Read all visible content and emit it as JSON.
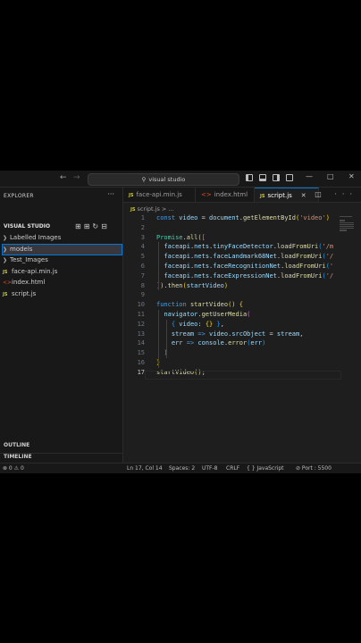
{
  "titlebar": {
    "search_text": "visual studio",
    "back_arrow": "←",
    "forward_arrow": "→",
    "window_controls": [
      "—",
      "□",
      "✕"
    ]
  },
  "sidebar": {
    "header": "EXPLORER",
    "more": "···",
    "section_title": "VISUAL STUDIO",
    "tools": "⊞⊞↻⊟",
    "items": [
      {
        "label": "Labelled Images",
        "kind": "folder",
        "icon": "chevron-right-icon"
      },
      {
        "label": "models",
        "kind": "folder",
        "icon": "chevron-right-icon",
        "selected": true
      },
      {
        "label": "Test_Images",
        "kind": "folder",
        "icon": "chevron-right-icon"
      },
      {
        "label": "face-api.min.js",
        "kind": "js",
        "icon_text": "JS"
      },
      {
        "label": "index.html",
        "kind": "html",
        "icon_text": "<>"
      },
      {
        "label": "script.js",
        "kind": "js",
        "icon_text": "JS"
      }
    ],
    "outline": "OUTLINE",
    "timeline": "TIMELINE"
  },
  "tabs": [
    {
      "label": "face-api.min.js",
      "icon_text": "JS",
      "kind": "js",
      "active": false
    },
    {
      "label": "index.html",
      "icon_text": "<>",
      "kind": "html",
      "active": false
    },
    {
      "label": "script.js",
      "icon_text": "JS",
      "kind": "js",
      "active": true,
      "close": "✕"
    }
  ],
  "tab_actions": "◫ ···",
  "breadcrumb": {
    "icon_text": "JS",
    "text": "script.js > ..."
  },
  "code_lines": [
    {
      "n": "1",
      "html": "<span class=\"kw\">const</span> <span class=\"var\">video</span> <span class=\"pl\">=</span> <span class=\"var\">document</span><span class=\"pl\">.</span><span class=\"fn\">getElementById</span><span class=\"br1\">(</span><span class=\"str\">'video'</span><span class=\"br1\">)</span>"
    },
    {
      "n": "2",
      "html": ""
    },
    {
      "n": "3",
      "html": "<span class=\"obj\">Promise</span><span class=\"pl\">.</span><span class=\"fn\">all</span><span class=\"br1\">(</span><span class=\"br2\">[</span>"
    },
    {
      "n": "4",
      "html": "  <span class=\"var\">faceapi</span><span class=\"pl\">.</span><span class=\"var\">nets</span><span class=\"pl\">.</span><span class=\"var\">tinyFaceDetector</span><span class=\"pl\">.</span><span class=\"fn\">loadFromUri</span><span class=\"br3\">(</span><span class=\"str\">'/m</span>"
    },
    {
      "n": "5",
      "html": "  <span class=\"var\">faceapi</span><span class=\"pl\">.</span><span class=\"var\">nets</span><span class=\"pl\">.</span><span class=\"var\">faceLandmark68Net</span><span class=\"pl\">.</span><span class=\"fn\">loadFromUri</span><span class=\"br3\">(</span><span class=\"str\">'/</span>"
    },
    {
      "n": "6",
      "html": "  <span class=\"var\">faceapi</span><span class=\"pl\">.</span><span class=\"var\">nets</span><span class=\"pl\">.</span><span class=\"var\">faceRecognitionNet</span><span class=\"pl\">.</span><span class=\"fn\">loadFromUri</span><span class=\"br3\">(</span><span class=\"str\">'</span>"
    },
    {
      "n": "7",
      "html": "  <span class=\"var\">faceapi</span><span class=\"pl\">.</span><span class=\"var\">nets</span><span class=\"pl\">.</span><span class=\"var\">faceExpressionNet</span><span class=\"pl\">.</span><span class=\"fn\">loadFromUri</span><span class=\"br3\">(</span><span class=\"str\">'/</span>"
    },
    {
      "n": "8",
      "html": "<span class=\"br2\">]</span><span class=\"br1\">)</span><span class=\"pl\">.</span><span class=\"fn\">then</span><span class=\"br1\">(</span><span class=\"var\">startVideo</span><span class=\"br1\">)</span>"
    },
    {
      "n": "9",
      "html": ""
    },
    {
      "n": "10",
      "html": "<span class=\"kw\">function</span> <span class=\"fn\">startVideo</span><span class=\"br1\">()</span> <span class=\"br1\">{</span>"
    },
    {
      "n": "11",
      "html": "  <span class=\"var\">navigator</span><span class=\"pl\">.</span><span class=\"fn\">getUserMedia</span><span class=\"br2\">(</span>"
    },
    {
      "n": "12",
      "html": "    <span class=\"br3\">{</span> <span class=\"var\">video</span><span class=\"pl\">:</span> <span class=\"br1\">{}</span> <span class=\"br3\">}</span><span class=\"pl\">,</span>"
    },
    {
      "n": "13",
      "html": "    <span class=\"var\">stream</span> <span class=\"kw\">=&gt;</span> <span class=\"var\">video</span><span class=\"pl\">.</span><span class=\"var\">srcObject</span> <span class=\"pl\">=</span> <span class=\"var\">stream</span><span class=\"pl\">,</span>"
    },
    {
      "n": "14",
      "html": "    <span class=\"var\">err</span> <span class=\"kw\">=&gt;</span> <span class=\"var\">console</span><span class=\"pl\">.</span><span class=\"fn\">error</span><span class=\"br3\">(</span><span class=\"var\">err</span><span class=\"br3\">)</span>"
    },
    {
      "n": "15",
      "html": "  <span class=\"br2\">)</span>"
    },
    {
      "n": "16",
      "html": "<span class=\"br1\">}</span>"
    },
    {
      "n": "17",
      "html": "<span class=\"fn\">startVideo</span><span class=\"br1\">()</span><span class=\"pl\">;</span>"
    }
  ],
  "status": {
    "errors": "⊗ 0 ⚠ 0",
    "position": "Ln 17, Col 14",
    "spaces": "Spaces: 2",
    "encoding": "UTF-8",
    "eol": "CRLF",
    "language": "{ } JavaScript",
    "port": "⊘ Port : 5500"
  },
  "colors": {
    "accent": "#0078d4",
    "editor_bg": "#1e1e1e",
    "sidebar_bg": "#181818"
  }
}
